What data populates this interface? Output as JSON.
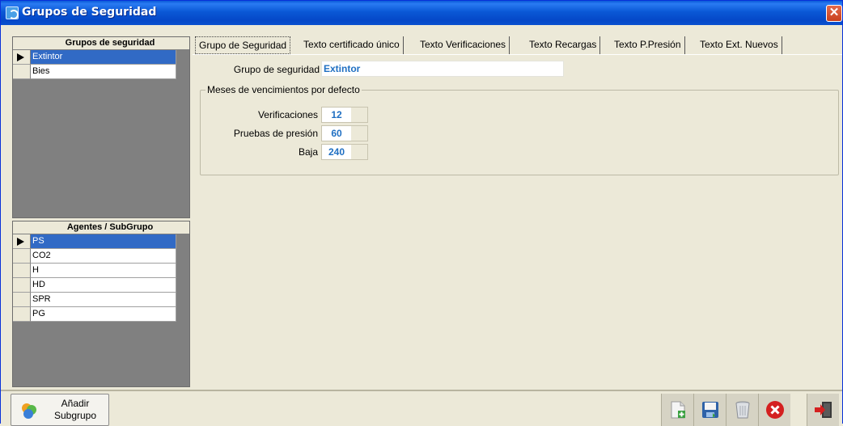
{
  "window": {
    "title": "Grupos de Seguridad"
  },
  "groups_grid": {
    "header": "Grupos de seguridad",
    "rows": [
      "Extintor",
      "Bies"
    ],
    "selected_index": 0
  },
  "agents_grid": {
    "header": "Agentes / SubGrupo",
    "rows": [
      "PS",
      "CO2",
      "H",
      "HD",
      "SPR",
      "PG"
    ],
    "selected_index": 0
  },
  "tabs": [
    {
      "label": "Grupo de Seguridad",
      "active": true
    },
    {
      "label": "Texto certificado único"
    },
    {
      "label": "Texto Verificaciones"
    },
    {
      "label": "Texto Recargas"
    },
    {
      "label": "Texto P.Presión"
    },
    {
      "label": "Texto Ext. Nuevos"
    }
  ],
  "form": {
    "group_label": "Grupo de seguridad",
    "group_value": "Extintor",
    "groupbox_title": "Meses de vencimientos por defecto",
    "fields": [
      {
        "label": "Verificaciones",
        "value": "12"
      },
      {
        "label": "Pruebas de presión",
        "value": "60"
      },
      {
        "label": "Baja",
        "value": "240"
      }
    ]
  },
  "bottom": {
    "add_line1": "Añadir",
    "add_line2": "Subgrupo",
    "icons": [
      "new-record-icon",
      "save-icon",
      "delete-icon",
      "cancel-icon",
      "exit-icon"
    ]
  },
  "colors": {
    "title_bar": "#0a58d6",
    "selection": "#316ac5",
    "value_text": "#1f6fc2",
    "grid_bg": "#808080"
  }
}
